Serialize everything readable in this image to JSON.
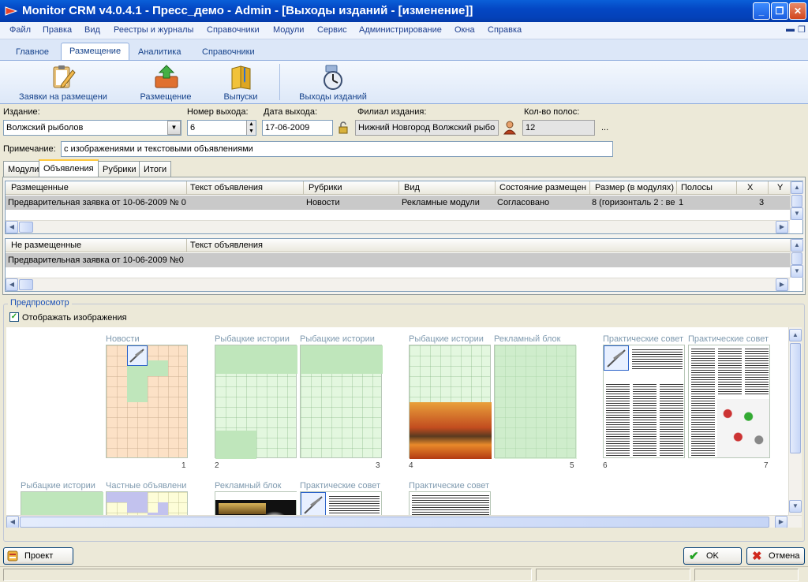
{
  "window": {
    "title": "Monitor CRM v4.0.4.1 - Пресс_демо - Admin - [Выходы изданий - [изменение]]"
  },
  "menu": {
    "items": [
      "Файл",
      "Правка",
      "Вид",
      "Реестры и журналы",
      "Справочники",
      "Модули",
      "Сервис",
      "Администрирование",
      "Окна",
      "Справка"
    ]
  },
  "ribbon": {
    "tabs": [
      "Главное",
      "Размещение",
      "Аналитика",
      "Справочники"
    ],
    "active_tab": "Размещение",
    "buttons": [
      "Заявки на размещени",
      "Размещение",
      "Выпуски",
      "Выходы изданий"
    ]
  },
  "form": {
    "edition_label": "Издание:",
    "edition_value": "Волжский рыболов",
    "issue_number_label": "Номер выхода:",
    "issue_number_value": "6",
    "issue_date_label": "Дата выхода:",
    "issue_date_value": "17-06-2009",
    "branch_label": "Филиал издания:",
    "branch_value": "Нижний Новгород Волжский рыбо",
    "pages_label": "Кол-во полос:",
    "pages_value": "12",
    "ellipsis": "...",
    "note_label": "Примечание:",
    "note_value": "с изображениями и текстовыми объявлениями"
  },
  "tabs": {
    "items": [
      "Модули",
      "Объявления",
      "Рубрики",
      "Итоги"
    ],
    "active": "Объявления"
  },
  "placed_grid": {
    "headers": [
      "Размещенные",
      "Текст объявления",
      "Рубрики",
      "Вид",
      "Состояние размещен",
      "Размер (в модулях)",
      "Полосы",
      "X",
      "Y"
    ],
    "row": [
      "Предварительная заявка от 10-06-2009 № 0",
      "",
      "Новости",
      "Рекламные модули",
      "Согласовано",
      "8 (горизонталь 2 : ве",
      "1",
      "3",
      ""
    ]
  },
  "unplaced_grid": {
    "headers": [
      "Не размещенные",
      "Текст объявления"
    ],
    "row": [
      "Предварительная заявка от 10-06-2009 №0"
    ]
  },
  "preview": {
    "title": "Предпросмотр",
    "show_images_label": "Отображать изображения",
    "show_images_checked": true,
    "page_labels": [
      "Новости",
      "Рыбацкие истории",
      "Рыбацкие истории",
      "Рыбацкие истории",
      "Рекламный блок",
      "Практические совет",
      "Практические совет",
      "Рыбацкие истории",
      "Частные объявлени",
      "Рекламный блок",
      "Практические совет",
      "Практические совет"
    ],
    "page_numbers": [
      "1",
      "2",
      "3",
      "4",
      "5",
      "6",
      "7"
    ]
  },
  "bottom": {
    "project_label": "Проект",
    "ok_label": "OK",
    "cancel_label": "Отмена"
  },
  "colors": {
    "titlebar": "#0447C4",
    "active_tab_accent": "#FFC83C",
    "selected_row": "#C9C9C9"
  }
}
